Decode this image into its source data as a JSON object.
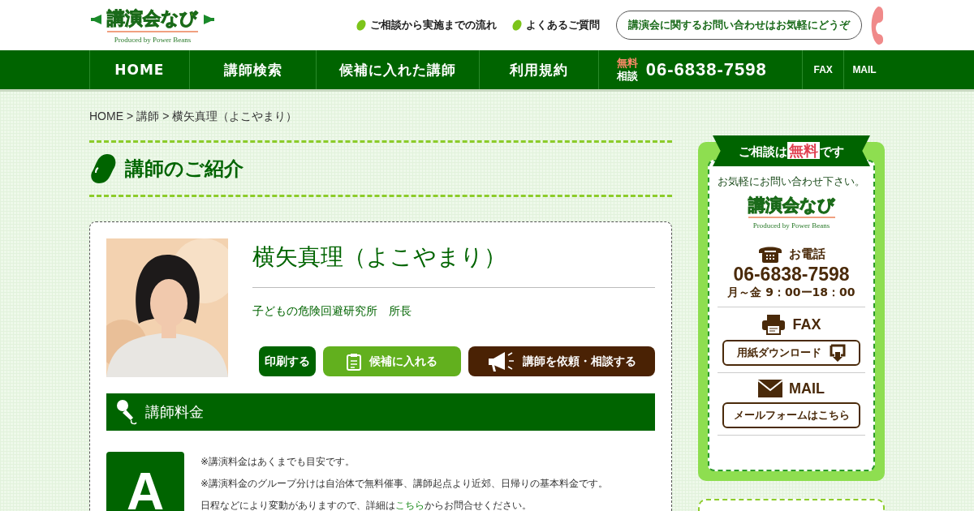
{
  "header": {
    "logo": {
      "title": "講演会なび",
      "tagline": "Produced by Power Beans"
    },
    "links": [
      "ご相談から実施までの流れ",
      "よくあるご質問"
    ],
    "contact_bubble": "講演会に関するお問い合わせはお気軽にどうぞ"
  },
  "nav": {
    "items": [
      "HOME",
      "講師検索",
      "候補に入れた講師",
      "利用規約"
    ],
    "phone": {
      "badge_top": "無料",
      "badge_bottom": "相談",
      "number": "06-6838-7598"
    },
    "icon_links": [
      "FAX",
      "MAIL"
    ]
  },
  "breadcrumb": {
    "separator": ">",
    "items": [
      "HOME",
      "講師",
      "横矢真理（よこやまり）"
    ]
  },
  "page_heading": "講師のご紹介",
  "profile": {
    "name": "横矢真理（よこやまり）",
    "title": "子どもの危険回避研究所　所長",
    "buttons": [
      {
        "label": "印刷する",
        "kind": "print"
      },
      {
        "label": "候補に入れる",
        "kind": "candidate"
      },
      {
        "label": "講師を依頼・相談する",
        "kind": "request"
      }
    ]
  },
  "fee_section": {
    "title": "講師料金",
    "grade": "A",
    "notes": [
      {
        "text": "※講演料金はあくまでも目安です。"
      },
      {
        "text": "※講演料金のグループ分けは自治体で無料催事、講師起点より近郊、日帰りの基本料金です。"
      },
      {
        "text": "日程などにより変動がありますので、詳細は",
        "link": "こちら",
        "after": "からお問合せください。"
      }
    ]
  },
  "sidebar": {
    "ribbon": {
      "before": "ご相談は",
      "highlight": "無料",
      "after": "です"
    },
    "intro": "お気軽にお問い合わせ下さい。",
    "logo": {
      "title": "講演会なび",
      "tagline": "Produced by Power Beans"
    },
    "phone": {
      "label": "お電話",
      "number": "06-6838-7598",
      "hours": "月～金 9：00ー18：00"
    },
    "fax": {
      "label": "FAX",
      "button": "用紙ダウンロード"
    },
    "mail": {
      "label": "MAIL",
      "button": "メールフォームはこちら"
    }
  }
}
